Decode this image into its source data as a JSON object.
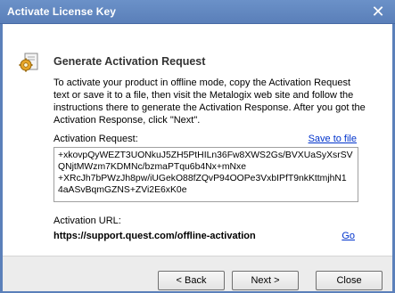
{
  "window": {
    "title": "Activate License Key",
    "close_glyph": "✕"
  },
  "header": {
    "title": "Generate Activation Request",
    "icon": "gear-document-icon"
  },
  "instructions": "To activate your product in offline mode, copy the Activation Request text or save it to a file, then visit the Metalogix web site and follow the instructions there to generate the Activation Response. After you got the Activation Response, click \"Next\".",
  "request": {
    "label": "Activation Request:",
    "save_link": "Save to file",
    "lines": [
      "+xkovpQyWEZT3UONkuJ5ZH5PtHILn36Fw8XWS2Gs/BVXUaSyXsrSV",
      "QNjtMWzm7KDMNc/bzmaPTqu6b4Nx+mNxe",
      "+XRcJh7bPWzJh8pw/iUGekO88fZQvP94OOPe3VxbIPfT9nkKttmjhN1",
      "4aASvBqmGZNS+ZVi2E6xK0e"
    ]
  },
  "url": {
    "label": "Activation URL:",
    "value": "https://support.quest.com/offline-activation",
    "go_link": "Go"
  },
  "buttons": {
    "back": "< Back",
    "next": "Next >",
    "close": "Close"
  }
}
